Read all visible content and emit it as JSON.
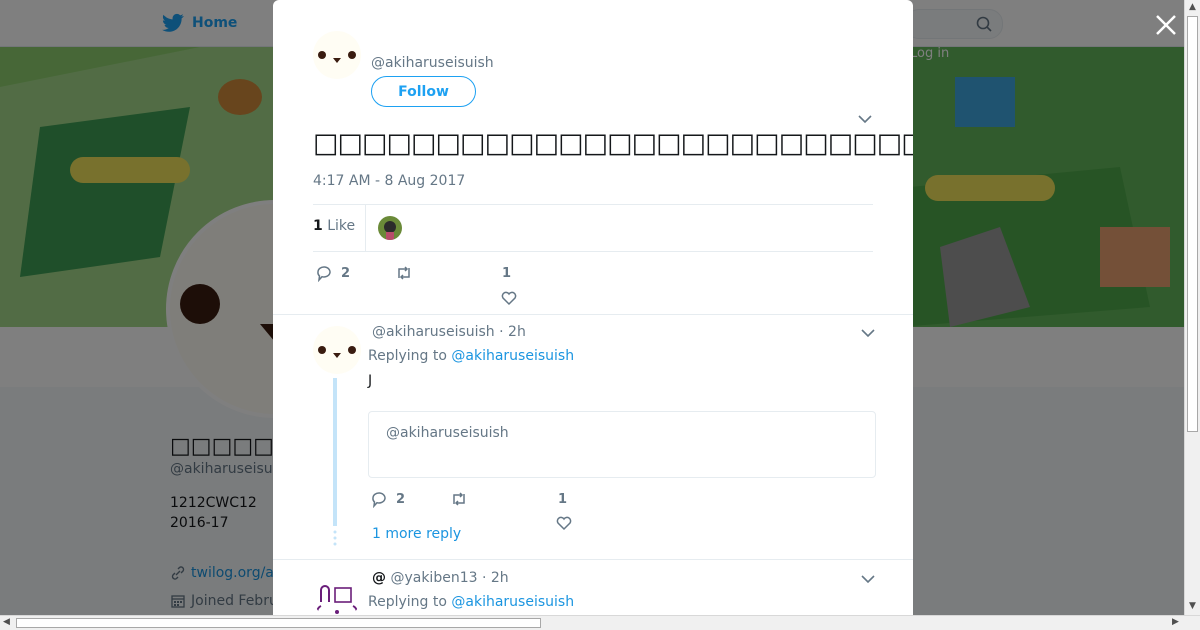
{
  "nav": {
    "home_label": "Home",
    "login_label": "Log in",
    "twitter_icon": "twitter-bird-icon",
    "search_icon": "search-icon"
  },
  "profile": {
    "name": "□□□□□□",
    "handle": "@akiharuseisuis",
    "bio_line1": "1212CWC12",
    "bio_line2": "2016-17",
    "link": "twilog.org/a",
    "joined": "Joined Febru"
  },
  "modal": {
    "main_tweet": {
      "handle": "@akiharuseisuish",
      "follow_label": "Follow",
      "text": "□□□□□□□□□□□□□□□□□□□□□□□□□□□□□□□□□□□□□□□□□□□□□□",
      "timestamp": "4:17 AM - 8 Aug 2017",
      "likes_count": "1",
      "likes_label": "Like",
      "reply_count": "2",
      "like_count_action": "1"
    },
    "replies": [
      {
        "handle": "@akiharuseisuish",
        "time": "· 2h",
        "replying_label": "Replying to",
        "replying_to": "@akiharuseisuish",
        "text": "J",
        "quote_handle": "@akiharuseisuish",
        "reply_count": "2",
        "like_count": "1",
        "more_replies": "1 more reply"
      },
      {
        "display_name": "@",
        "handle": "@yakiben13",
        "time": "· 2h",
        "replying_label": "Replying to",
        "replying_to": "@akiharuseisuish"
      }
    ]
  },
  "colors": {
    "accent": "#1da1f2",
    "link": "#1b95e0",
    "thread": "#c4e4f9"
  }
}
